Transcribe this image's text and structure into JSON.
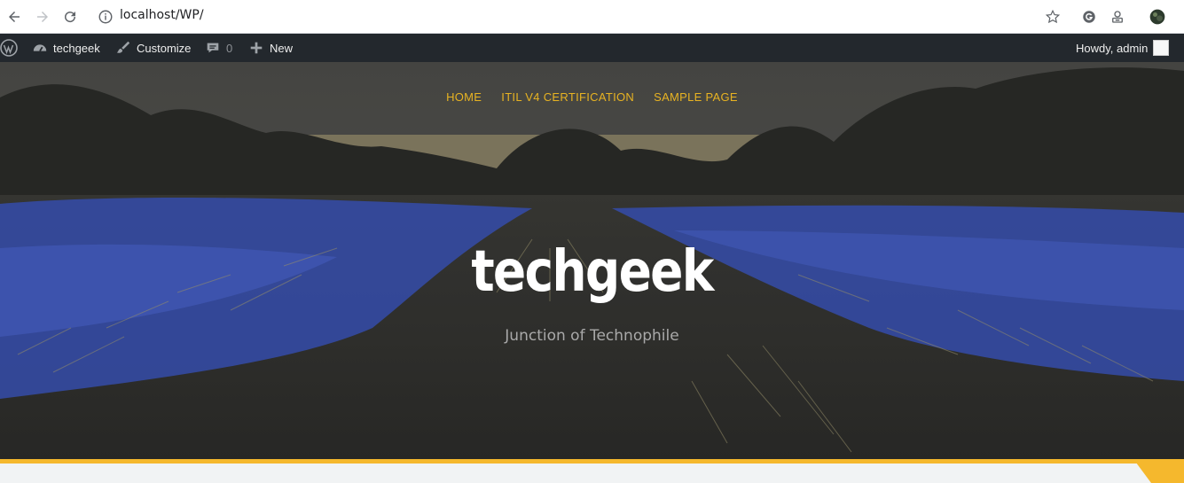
{
  "browser": {
    "url": "localhost/WP/",
    "icons": [
      "back-arrow-icon",
      "forward-arrow-icon",
      "reload-icon",
      "info-icon",
      "star-icon",
      "extension-icon",
      "profile-avatar"
    ]
  },
  "admin_bar": {
    "site_name": "techgeek",
    "customize": "Customize",
    "comments_count": "0",
    "new_label": "New",
    "howdy": "Howdy, admin",
    "colors": {
      "background": "#23282d",
      "text": "#eeeeee"
    }
  },
  "nav": {
    "items": [
      "HOME",
      "ITIL V4 CERTIFICATION",
      "SAMPLE PAGE"
    ],
    "color": "#e8b322"
  },
  "hero": {
    "title": "techgeek",
    "tagline": "Junction of Technophile"
  },
  "colors": {
    "accent": "#f5b82d",
    "hero_blue": "#3a54b8",
    "hero_dark": "#2e2f2c"
  }
}
